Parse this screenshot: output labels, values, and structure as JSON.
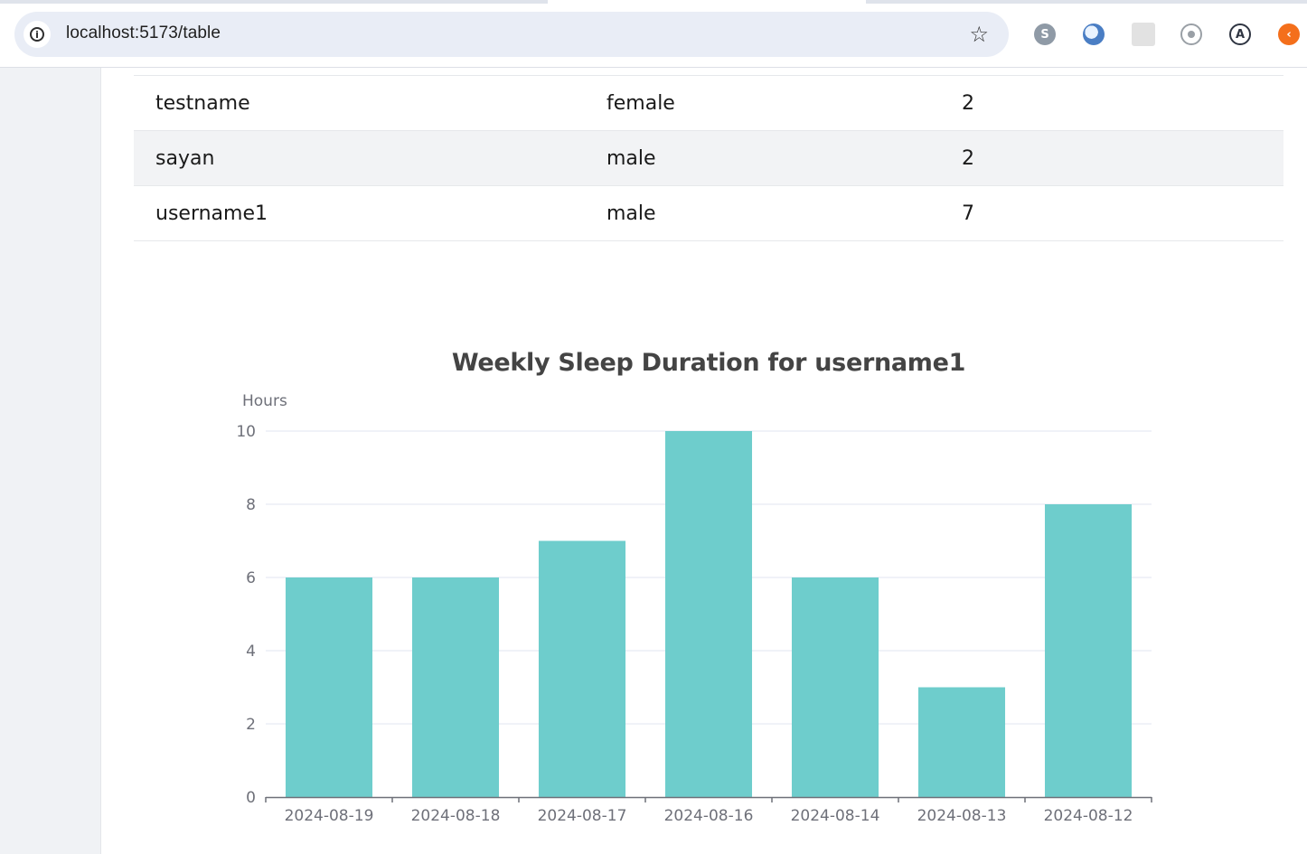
{
  "browser": {
    "url": "localhost:5173/table",
    "extensions": [
      "skype-icon",
      "blue-circle-icon",
      "grey-square-icon",
      "target-icon",
      "a-circle-icon",
      "orange-icon"
    ]
  },
  "table": {
    "rows": [
      {
        "name": "testname",
        "gender": "female",
        "count": "2"
      },
      {
        "name": "sayan",
        "gender": "male",
        "count": "2"
      },
      {
        "name": "username1",
        "gender": "male",
        "count": "7"
      }
    ]
  },
  "colors": {
    "bar": "#6ecdcc",
    "grid": "#e0e6f1",
    "axis": "#6e7079"
  },
  "chart_data": {
    "type": "bar",
    "title": "Weekly Sleep Duration for username1",
    "ylabel": "Hours",
    "xlabel": "",
    "categories": [
      "2024-08-19",
      "2024-08-18",
      "2024-08-17",
      "2024-08-16",
      "2024-08-14",
      "2024-08-13",
      "2024-08-12"
    ],
    "values": [
      6,
      6,
      7,
      10,
      6,
      3,
      8
    ],
    "ylim": [
      0,
      10
    ],
    "yticks": [
      0,
      2,
      4,
      6,
      8,
      10
    ],
    "grid": true,
    "legend": "none"
  }
}
